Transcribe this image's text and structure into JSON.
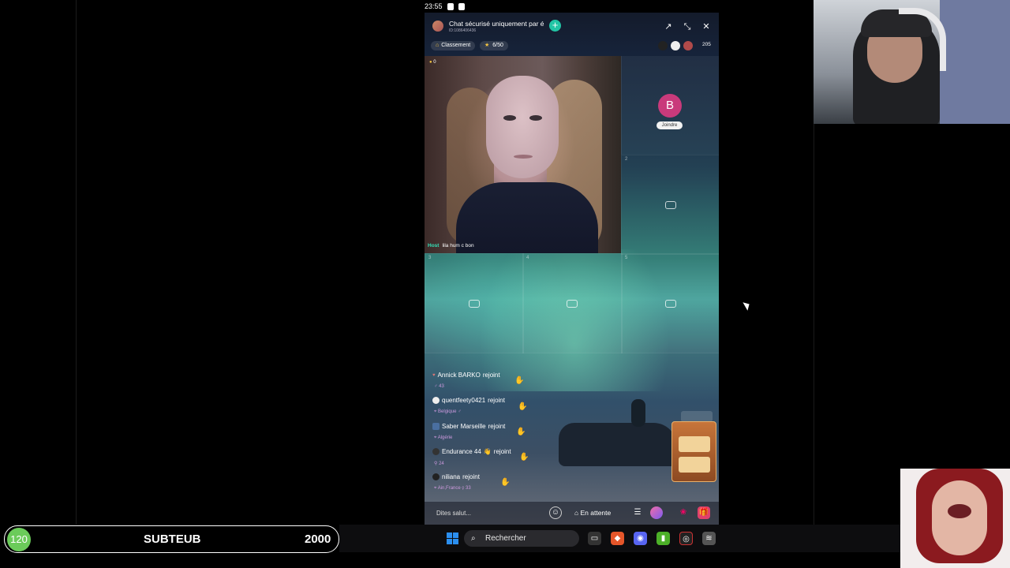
{
  "status_bar": {
    "time": "23:55"
  },
  "room": {
    "title": "Chat sécurisé uniquement par é",
    "id_text": "ID:1086406436",
    "rank_label": "Classement",
    "seats_used": "6/50",
    "viewer_count": "205"
  },
  "host": {
    "coin_count": "0",
    "tag": "Host",
    "name": "lila hum c bon"
  },
  "seats": {
    "seat1_initial": "B",
    "seat1_join": "Joindre",
    "numbers": [
      "2",
      "3",
      "4",
      "5"
    ]
  },
  "chat": [
    {
      "user": "Annick BARKO",
      "action": "rejoint",
      "meta": "43"
    },
    {
      "user": "quentfeety0421",
      "action": "rejoint",
      "meta": "Belgique"
    },
    {
      "user": "Saber Marseille",
      "action": "rejoint",
      "meta": "Algérie"
    },
    {
      "user": "Endurance 44",
      "action": "rejoint",
      "meta": "24"
    },
    {
      "user": "niliana",
      "action": "rejoint",
      "meta": "Ain,France",
      "meta2": "33"
    }
  ],
  "bottom_bar": {
    "input_placeholder": "Dites salut...",
    "waiting_label": "En attente"
  },
  "score_overlay": {
    "badge": "120",
    "name": "SUBTEUB",
    "goal": "2000"
  },
  "taskbar": {
    "search_placeholder": "Rechercher"
  },
  "colors": {
    "accent": "#22c5a5",
    "host_tag": "#35e0b8",
    "badge": "#6bcb5a"
  }
}
